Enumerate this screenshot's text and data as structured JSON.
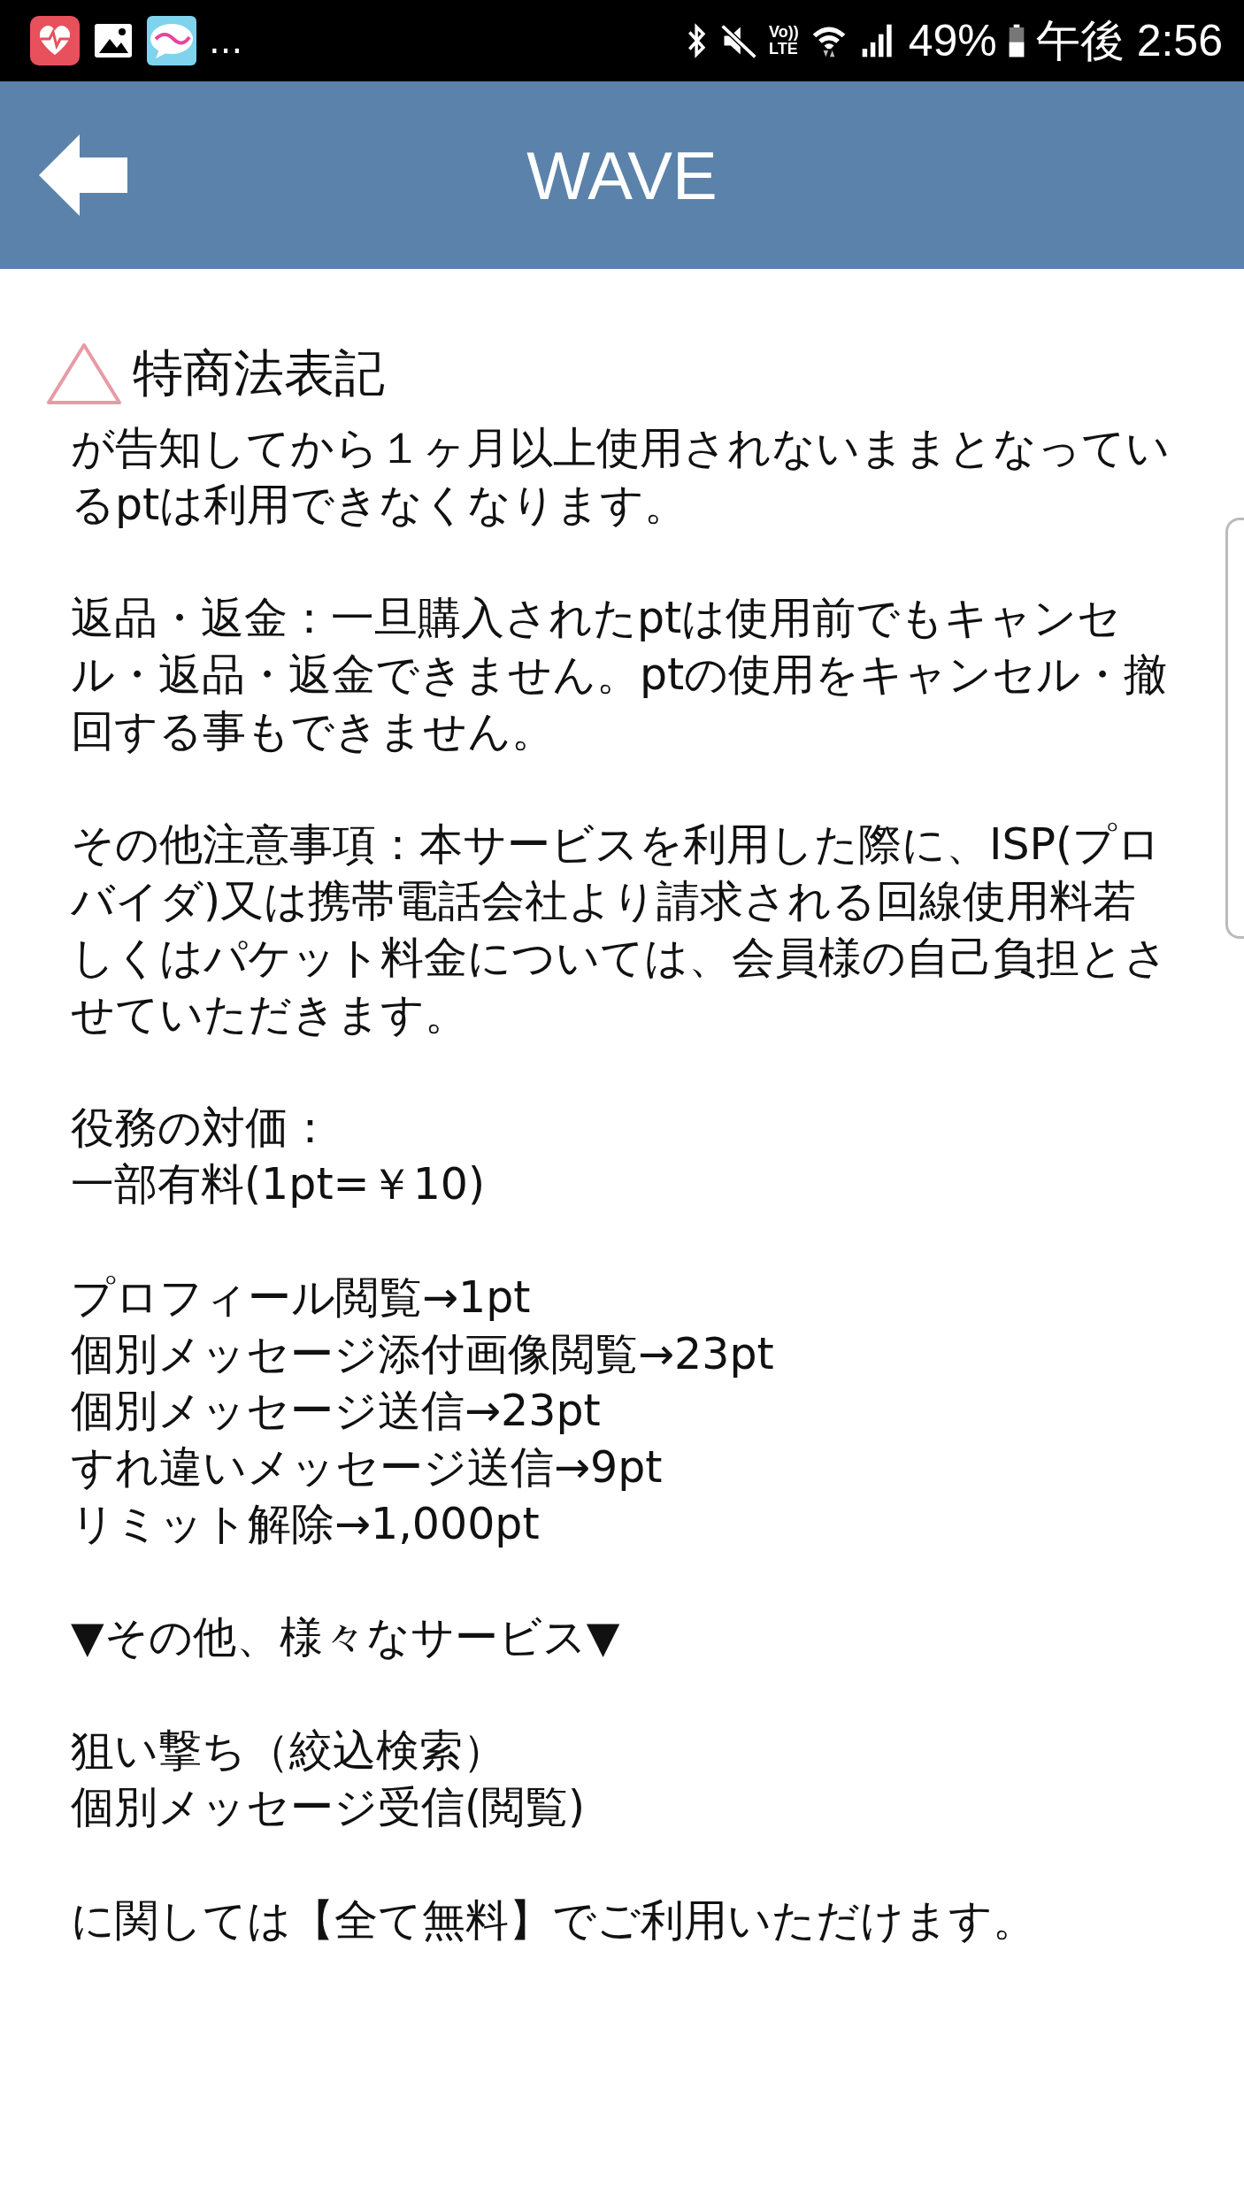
{
  "status_bar": {
    "more": "...",
    "volte": [
      "Vo))",
      "LTE"
    ],
    "battery": "49%",
    "time": "午後 2:56"
  },
  "header": {
    "title": "WAVE"
  },
  "section": {
    "title": "特商法表記"
  },
  "blocks": [
    {
      "lines": [
        "が告知してから１ヶ月以上使用されないままとなっているptは利用できなくなります。"
      ]
    },
    {
      "lines": [
        "返品・返金：一旦購入されたptは使用前でもキャンセル・返品・返金できません。ptの使用をキャンセル・撤回する事もできません。"
      ]
    },
    {
      "lines": [
        "その他注意事項：本サービスを利用した際に、ISP(プロバイダ)又は携帯電話会社より請求される回線使用料若しくはパケット料金については、会員様の自己負担とさせていただきます。"
      ]
    },
    {
      "lines": [
        "役務の対価：",
        "一部有料(1pt=￥10)"
      ]
    },
    {
      "lines": [
        "プロフィール閲覧→1pt",
        "個別メッセージ添付画像閲覧→23pt",
        "個別メッセージ送信→23pt",
        "すれ違いメッセージ送信→9pt",
        "リミット解除→1,000pt"
      ]
    },
    {
      "lines": [
        "▼その他、様々なサービス▼"
      ]
    },
    {
      "lines": [
        "狙い撃ち（絞込検索）",
        "個別メッセージ受信(閲覧)"
      ]
    },
    {
      "lines": [
        "に関しては【全て無料】でご利用いただけます。"
      ]
    }
  ]
}
